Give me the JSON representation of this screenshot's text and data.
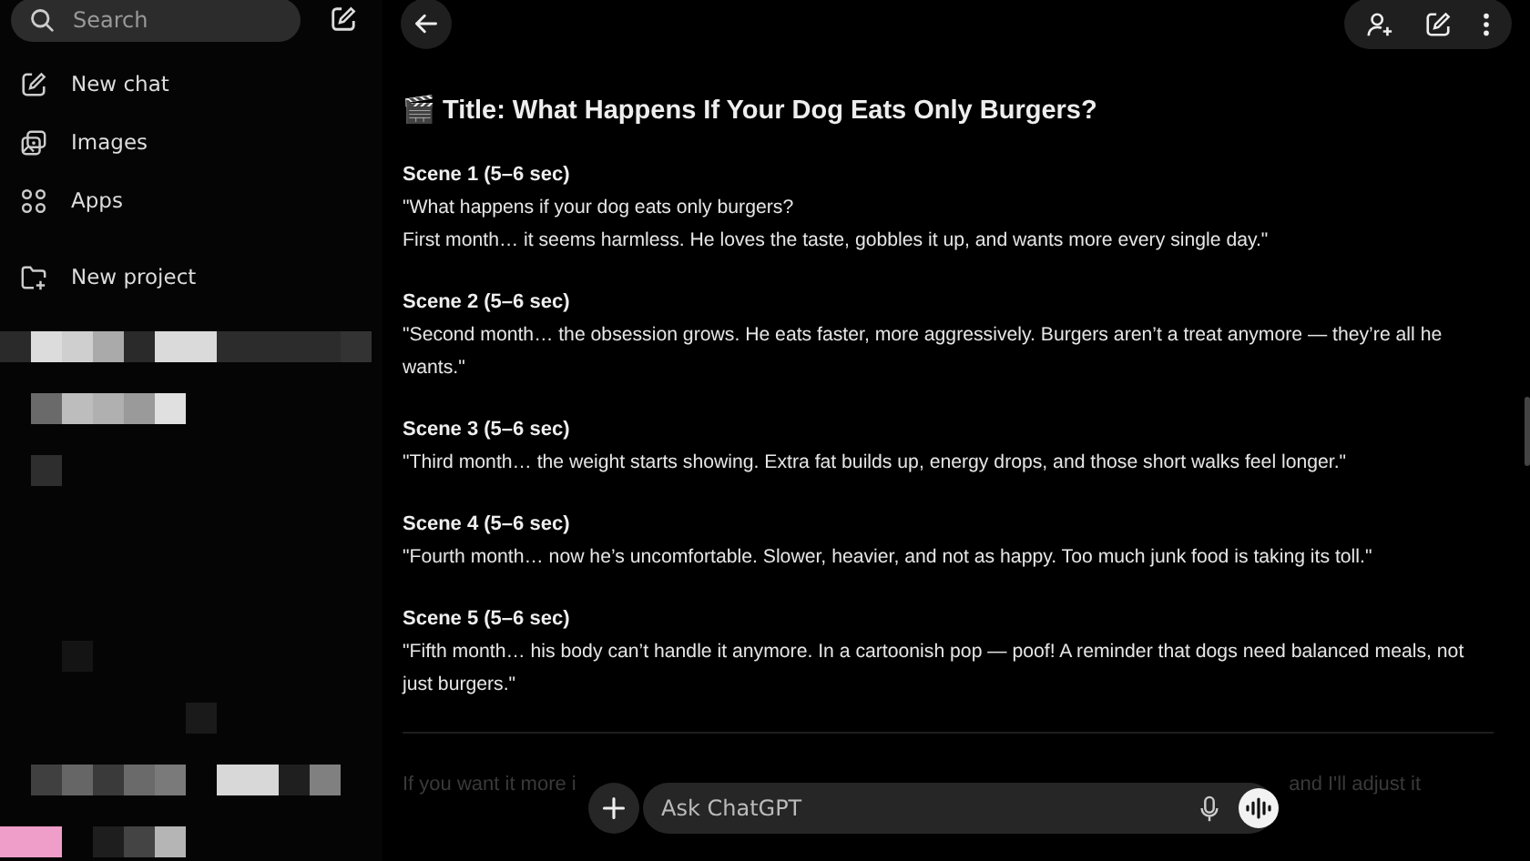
{
  "sidebar": {
    "search": {
      "placeholder": "Search"
    },
    "items": [
      {
        "label": "New chat"
      },
      {
        "label": "Images"
      },
      {
        "label": "Apps"
      },
      {
        "label": "New project"
      }
    ]
  },
  "chat": {
    "title": "🎬 Title: What Happens If Your Dog Eats Only Burgers?",
    "scenes": [
      {
        "heading": "Scene 1 (5–6 sec)",
        "lines": [
          "\"What happens if your dog eats only burgers?",
          "First month… it seems harmless. He loves the taste, gobbles it up, and wants more every single day.\""
        ]
      },
      {
        "heading": "Scene 2 (5–6 sec)",
        "lines": [
          "\"Second month… the obsession grows. He eats faster, more aggressively. Burgers aren’t a treat anymore — they’re all he wants.\""
        ]
      },
      {
        "heading": "Scene 3 (5–6 sec)",
        "lines": [
          "\"Third month… the weight starts showing. Extra fat builds up, energy drops, and those short walks feel longer.\""
        ]
      },
      {
        "heading": "Scene 4 (5–6 sec)",
        "lines": [
          "\"Fourth month… now he’s uncomfortable. Slower, heavier, and not as happy. Too much junk food is taking its toll.\""
        ]
      },
      {
        "heading": "Scene 5 (5–6 sec)",
        "lines": [
          "\"Fifth month… his body can’t handle it anymore. In a cartoonish pop — poof! A reminder that dogs need balanced meals, not just burgers.\""
        ]
      }
    ],
    "faded_left": "If you want it more i",
    "faded_right": "and I'll adjust it"
  },
  "composer": {
    "placeholder": "Ask ChatGPT"
  }
}
